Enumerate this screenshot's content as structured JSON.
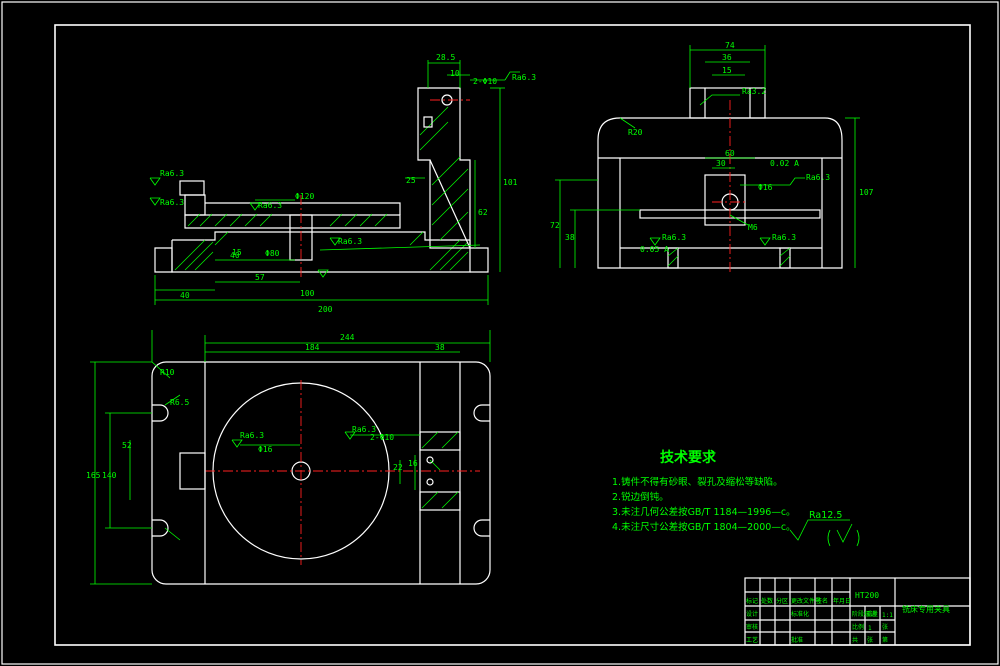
{
  "front_view": {
    "dims": {
      "width_overall": "200",
      "offset_40": "40",
      "dim_100": "100",
      "dim_57": "57",
      "dim_40b": "40",
      "top_28_5": "28.5",
      "top_10": "10",
      "hole_label": "2-Φ10",
      "height_101": "101",
      "height_62": "62",
      "dim_25": "25",
      "dim_120": "Φ120",
      "dim_80": "Φ80",
      "dim_15": "15"
    },
    "roughness": [
      "Ra6.3",
      "Ra6.3",
      "Ra6.3",
      "Ra6.3",
      "Ra6.3"
    ]
  },
  "side_view": {
    "dims": {
      "top_74": "74",
      "top_36": "36",
      "top_15": "15",
      "width_60": "60",
      "dim_30": "30",
      "bore": "Φ16",
      "height_107": "107",
      "height_72": "72",
      "height_38": "38",
      "radius": "R20",
      "thread": "M6",
      "tol_1": "0.02 A",
      "tol_2": "0.05 A"
    },
    "roughness": [
      "Ra6.3",
      "Ra3.2",
      "Ra6.3",
      "Ra6.3"
    ]
  },
  "top_view": {
    "dims": {
      "total_244": "244",
      "dim_184": "184",
      "dim_38": "38",
      "height_165": "165",
      "dim_140": "140",
      "dim_52": "52",
      "dim_22": "22",
      "dim_16": "16",
      "center_hole": "Φ16",
      "hole_pair": "2-Φ10",
      "slot_r": "R6.5",
      "chamfer": "R10"
    },
    "roughness": [
      "Ra6.3",
      "Ra6.3"
    ]
  },
  "notes": {
    "title": "技术要求",
    "items": [
      "1.铸件不得有砂眼、裂孔及缩松等缺陷。",
      "2.锐边倒钝。",
      "3.未注几何公差按GB/T 1184—1996—c。",
      "4.未注尺寸公差按GB/T 1804—2000—c。"
    ],
    "general_roughness": "Ra12.5"
  },
  "title_block": {
    "material": "HT200",
    "drawing_name": "铣床专用夹具",
    "scale": "1:1",
    "sheet": "1",
    "cells": [
      "标记",
      "处数",
      "分区",
      "更改文件号",
      "签名",
      "年月日",
      "设计",
      "标准化",
      "阶段标记",
      "重量",
      "比例",
      "审核",
      "工艺",
      "批准",
      "共",
      "张",
      "第",
      "张"
    ]
  }
}
